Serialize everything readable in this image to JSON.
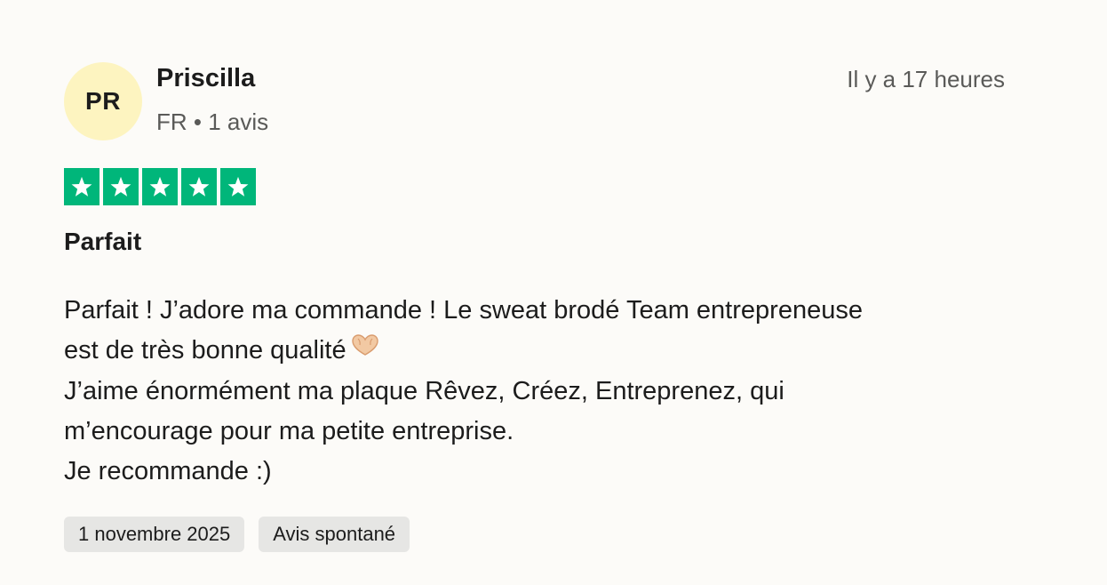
{
  "reviewer": {
    "initials": "PR",
    "name": "Priscilla",
    "meta": "FR • 1 avis",
    "avatar_color": "#fdf4c0"
  },
  "review": {
    "relative_date": "Il y a 17 heures",
    "rating": 5,
    "rating_max": 5,
    "star_color": "#00b67a",
    "title": "Parfait",
    "body_lines": [
      "Parfait ! J’adore ma commande ! Le sweat brodé Team entrepreneuse",
      "est de très bonne qualité",
      "J’aime énormément ma plaque Rêvez, Créez, Entreprenez, qui",
      "m’encourage pour ma petite entreprise.",
      "Je recommande :)"
    ],
    "emoji": "heart-hands-icon"
  },
  "tags": {
    "date": "1 novembre 2025",
    "type": "Avis spontané"
  }
}
